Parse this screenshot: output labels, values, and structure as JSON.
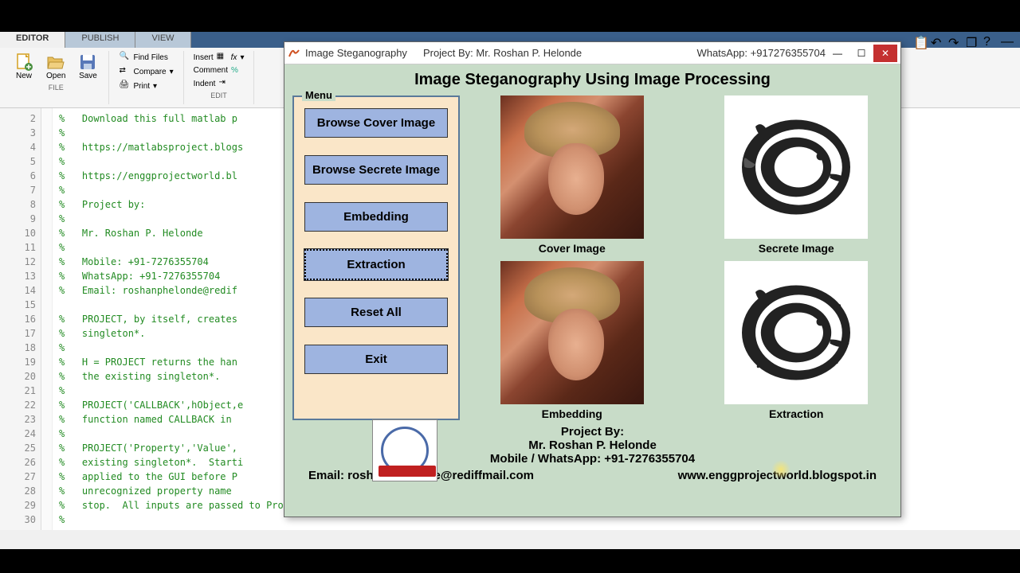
{
  "matlab": {
    "tabs": {
      "editor": "EDITOR",
      "publish": "PUBLISH",
      "view": "VIEW"
    },
    "toolbar": {
      "new": "New",
      "open": "Open",
      "save": "Save",
      "findfiles": "Find Files",
      "compare": "Compare",
      "print": "Print",
      "insert": "Insert",
      "comment": "Comment",
      "indent": "Indent",
      "file_group": "FILE",
      "edit_group": "EDIT"
    },
    "lines": [
      "2",
      "3",
      "4",
      "5",
      "6",
      "7",
      "8",
      "9",
      "10",
      "11",
      "12",
      "13",
      "14",
      "15",
      "16",
      "17",
      "18",
      "19",
      "20",
      "21",
      "22",
      "23",
      "24",
      "25",
      "26",
      "27",
      "28",
      "29",
      "30"
    ],
    "code": {
      "l2": "%   Download this full matlab p",
      "l3": "%",
      "l4": "%   https://matlabsproject.blogs",
      "l5": "%",
      "l6": "%   https://enggprojectworld.bl",
      "l7": "%",
      "l8": "%   Project by:",
      "l9": "%",
      "l10": "%   Mr. Roshan P. Helonde",
      "l11": "%",
      "l12": "%   Mobile: +91-7276355704",
      "l13": "%   WhatsApp: +91-7276355704",
      "l14": "%   Email: roshanphelonde@redif",
      "l15": "",
      "l16": "%   PROJECT, by itself, creates",
      "l17": "%   singleton*.",
      "l18": "%",
      "l19": "%   H = PROJECT returns the han",
      "l20": "%   the existing singleton*.",
      "l21": "%",
      "l22": "%   PROJECT('CALLBACK',hObject,e",
      "l23": "%   function named CALLBACK in ",
      "l24": "%",
      "l25": "%   PROJECT('Property','Value',",
      "l26": "%   existing singleton*.  Starti",
      "l27": "%   applied to the GUI before P",
      "l28": "%   unrecognized property name ",
      "l29": "%   stop.  All inputs are passed to Project_OpeningFcn via varargin.",
      "l30": "%"
    }
  },
  "gui": {
    "titlebar": {
      "title": "Image Steganography",
      "project_by": "Project By: Mr. Roshan P. Helonde",
      "whatsapp": "WhatsApp: +917276355704"
    },
    "heading": "Image Steganography Using Image Processing",
    "menu": {
      "legend": "Menu",
      "browse_cover": "Browse Cover Image",
      "browse_secret": "Browse Secrete Image",
      "embedding": "Embedding",
      "extraction": "Extraction",
      "reset": "Reset All",
      "exit": "Exit"
    },
    "labels": {
      "cover": "Cover Image",
      "secret": "Secrete Image",
      "embedding": "Embedding",
      "extraction": "Extraction"
    },
    "footer": {
      "project_by": "Project By:",
      "author": "Mr. Roshan P. Helonde",
      "contact": "Mobile / WhatsApp: +91-7276355704",
      "email": "Email: roshanphelonde@rediffmail.com",
      "website": "www.enggprojectworld.blogspot.in"
    }
  }
}
